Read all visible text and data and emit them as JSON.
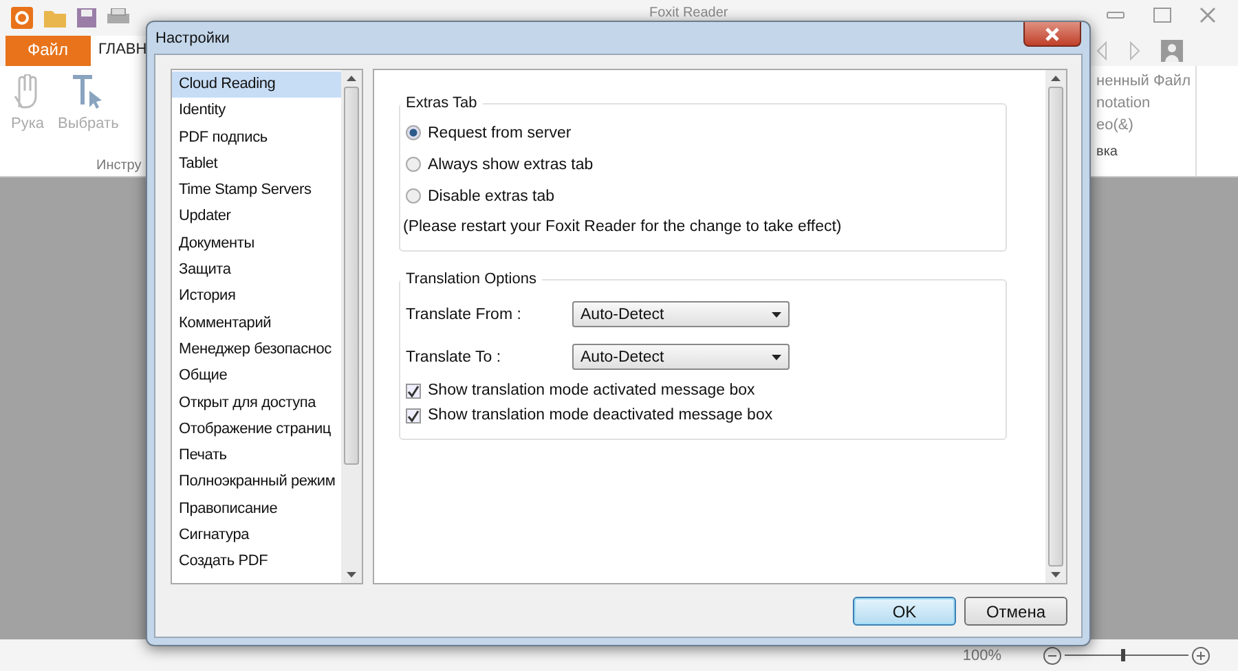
{
  "app": {
    "title": "Foxit Reader",
    "tabs": [
      {
        "label": "Файл",
        "kind": "file"
      },
      {
        "label": "ГЛАВН",
        "kind": "home"
      }
    ],
    "tools": [
      {
        "label": "Рука",
        "kind": "hand"
      },
      {
        "label": "Выбрать",
        "kind": "select"
      }
    ],
    "group_label": "Инстру",
    "right_items": [
      "ненный Файл",
      "notation",
      "ео(&)"
    ],
    "right_group_label": "вка",
    "zoom": "100%",
    "zoom_slider": {
      "level": 0.45
    }
  },
  "dialog": {
    "title": "Настройки",
    "categories": [
      {
        "label": "Cloud Reading",
        "selected": true
      },
      {
        "label": "Identity",
        "selected": false
      },
      {
        "label": "PDF подпись",
        "selected": false
      },
      {
        "label": "Tablet",
        "selected": false
      },
      {
        "label": "Time Stamp Servers",
        "selected": false
      },
      {
        "label": "Updater",
        "selected": false
      },
      {
        "label": "Документы",
        "selected": false
      },
      {
        "label": "Защита",
        "selected": false
      },
      {
        "label": "История",
        "selected": false
      },
      {
        "label": "Комментарий",
        "selected": false
      },
      {
        "label": "Менеджер безопаснос",
        "selected": false
      },
      {
        "label": "Общие",
        "selected": false
      },
      {
        "label": "Открыт для доступа",
        "selected": false
      },
      {
        "label": "Отображение страниц",
        "selected": false
      },
      {
        "label": "Печать",
        "selected": false
      },
      {
        "label": "Полноэкранный режим",
        "selected": false
      },
      {
        "label": "Правописание",
        "selected": false
      },
      {
        "label": "Сигнатура",
        "selected": false
      },
      {
        "label": "Создать PDF",
        "selected": false
      }
    ],
    "extras": {
      "title": "Extras Tab",
      "options": [
        {
          "label": "Request from server",
          "selected": true
        },
        {
          "label": "Always show extras tab",
          "selected": false
        },
        {
          "label": "Disable extras tab",
          "selected": false
        }
      ],
      "note": "(Please restart your Foxit Reader for the change to take effect)"
    },
    "translation": {
      "title": "Translation Options",
      "fields": [
        {
          "label": "Translate From :",
          "value": "Auto-Detect"
        },
        {
          "label": "Translate To :",
          "value": "Auto-Detect"
        }
      ],
      "checks": [
        {
          "label": "Show translation mode activated message box",
          "checked": true
        },
        {
          "label": "Show translation mode deactivated message box",
          "checked": true
        }
      ]
    },
    "buttons": [
      {
        "label": "OK",
        "kind": "default"
      },
      {
        "label": "Отмена",
        "kind": "normal"
      }
    ]
  }
}
